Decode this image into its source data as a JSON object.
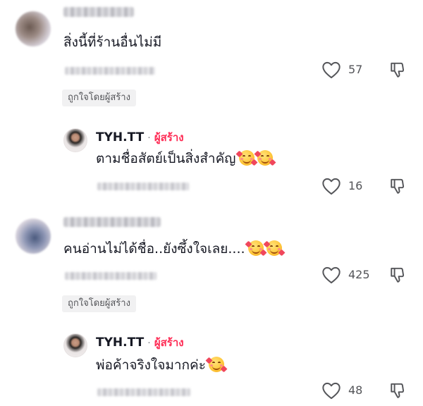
{
  "comments": [
    {
      "text": "สิ่งนี้ที่ร้านอื่นไม่มี",
      "like_count": "57",
      "liked_by_creator": "ถูกใจโดยผู้สร้าง",
      "reply": {
        "username": "TYH.TT",
        "separator": "·",
        "badge": "ผู้สร้าง",
        "text": "ตามชื่อสัตย์เป็นสิ่งสำคัญ",
        "emojis": [
          "smiling-face-with-hearts-icon",
          "smiling-face-with-hearts-icon"
        ],
        "like_count": "16"
      }
    },
    {
      "text": "คนอ่านไม่ได้ชื่อ..ยังซึ้งใจเลย....",
      "emojis": [
        "smiling-face-with-hearts-icon",
        "smiling-face-with-hearts-icon"
      ],
      "like_count": "425",
      "liked_by_creator": "ถูกใจโดยผู้สร้าง",
      "reply": {
        "username": "TYH.TT",
        "separator": "·",
        "badge": "ผู้สร้าง",
        "text": "พ่อค้าจริงใจมากค่ะ",
        "emojis": [
          "smiling-face-with-hearts-icon"
        ],
        "like_count": "48"
      }
    }
  ],
  "colors": {
    "creator_badge": "#fe2c55",
    "text_primary": "#161823",
    "text_secondary": "#545559",
    "pill_bg": "#f1f1f2"
  }
}
